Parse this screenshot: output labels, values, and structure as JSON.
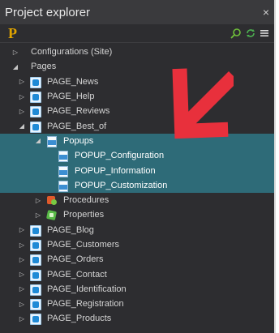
{
  "window": {
    "title": "Project explorer",
    "close": "×"
  },
  "toolbar": {
    "logo": "P"
  },
  "tree": [
    {
      "label": "Configurations (Site)",
      "level": 0,
      "arrow": "right",
      "icon": "none"
    },
    {
      "label": "Pages",
      "level": 0,
      "arrow": "down",
      "icon": "none"
    },
    {
      "label": "PAGE_News",
      "level": 1,
      "arrow": "right",
      "icon": "page"
    },
    {
      "label": "PAGE_Help",
      "level": 1,
      "arrow": "right",
      "icon": "page"
    },
    {
      "label": "PAGE_Reviews",
      "level": 1,
      "arrow": "right",
      "icon": "page"
    },
    {
      "label": "PAGE_Best_of",
      "level": 1,
      "arrow": "down",
      "icon": "page"
    },
    {
      "label": "Popups",
      "level": 2,
      "arrow": "down",
      "icon": "doc",
      "selected": true
    },
    {
      "label": "POPUP_Configuration",
      "level": 3,
      "arrow": "none",
      "icon": "doc",
      "selected": true
    },
    {
      "label": "POPUP_Information",
      "level": 3,
      "arrow": "none",
      "icon": "doc",
      "selected": true
    },
    {
      "label": "POPUP_Customization",
      "level": 3,
      "arrow": "none",
      "icon": "doc",
      "selected": true
    },
    {
      "label": "Procedures",
      "level": 2,
      "arrow": "right",
      "icon": "proc"
    },
    {
      "label": "Properties",
      "level": 2,
      "arrow": "right",
      "icon": "prop"
    },
    {
      "label": "PAGE_Blog",
      "level": 1,
      "arrow": "right",
      "icon": "page"
    },
    {
      "label": "PAGE_Customers",
      "level": 1,
      "arrow": "right",
      "icon": "page"
    },
    {
      "label": "PAGE_Orders",
      "level": 1,
      "arrow": "right",
      "icon": "page"
    },
    {
      "label": "PAGE_Contact",
      "level": 1,
      "arrow": "right",
      "icon": "page"
    },
    {
      "label": "PAGE_Identification",
      "level": 1,
      "arrow": "right",
      "icon": "page"
    },
    {
      "label": "PAGE_Registration",
      "level": 1,
      "arrow": "right",
      "icon": "page"
    },
    {
      "label": "PAGE_Products",
      "level": 1,
      "arrow": "right",
      "icon": "page"
    }
  ],
  "colors": {
    "selection": "#2e6b78",
    "annotation_arrow": "#e8303c",
    "logo": "#e0a400"
  },
  "icons": {
    "search": "search-icon",
    "sync": "sync-icon",
    "menu": "menu-icon"
  }
}
